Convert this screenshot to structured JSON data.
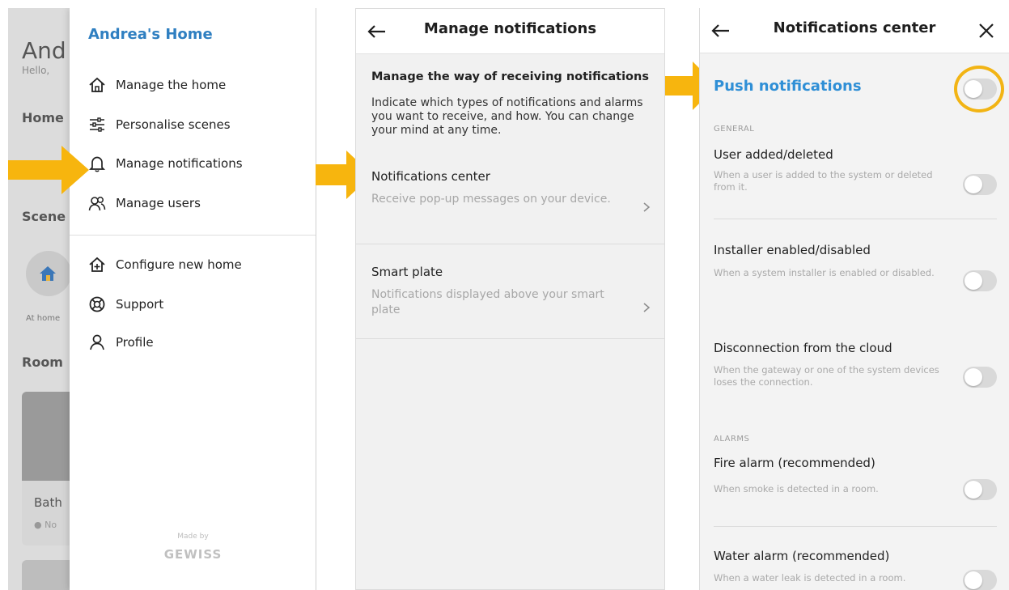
{
  "panel1": {
    "background": {
      "big_text": "And",
      "small_text": "Hello,",
      "section_home": "Home",
      "section_scenes": "Scene",
      "scene_label": "At home",
      "section_rooms": "Room",
      "room_card_title": "Bath",
      "room_card_status": "● No"
    },
    "drawer": {
      "title": "Andrea's Home",
      "items": [
        {
          "label": "Manage the home",
          "icon": "home-icon"
        },
        {
          "label": "Personalise scenes",
          "icon": "sliders-icon"
        },
        {
          "label": "Manage notifications",
          "icon": "bell-icon"
        },
        {
          "label": "Manage users",
          "icon": "users-icon"
        },
        {
          "label": "Configure new home",
          "icon": "home-plus-icon"
        },
        {
          "label": "Support",
          "icon": "lifebuoy-icon"
        },
        {
          "label": "Profile",
          "icon": "person-icon"
        }
      ],
      "made_by": "Made by",
      "brand": "GEWISS"
    }
  },
  "panel2": {
    "title": "Manage notifications",
    "intro_heading": "Manage the way of receiving notifications",
    "intro_text": "Indicate which types of notifications and alarms you want to receive, and how. You can change your mind at any time.",
    "rows": [
      {
        "title": "Notifications center",
        "subtitle": "Receive pop-up messages on your device."
      },
      {
        "title": "Smart plate",
        "subtitle": "Notifications displayed above your smart plate"
      }
    ]
  },
  "panel3": {
    "title": "Notifications center",
    "push_title": "Push notifications",
    "general_label": "GENERAL",
    "alarms_label": "ALARMS",
    "general_items": [
      {
        "title": "User added/deleted",
        "desc": "When a user is added to the system or deleted from it."
      },
      {
        "title": "Installer enabled/disabled",
        "desc": "When a system installer is enabled or disabled."
      },
      {
        "title": "Disconnection from the cloud",
        "desc": "When the gateway or one of the system devices loses the connection."
      }
    ],
    "alarm_items": [
      {
        "title": "Fire alarm (recommended)",
        "desc": "When smoke is detected in a room."
      },
      {
        "title": "Water alarm (recommended)",
        "desc": "When a water leak is detected in a room."
      }
    ]
  },
  "colors": {
    "accent_blue": "#2f8fd6",
    "highlight_yellow": "#f2b414",
    "toggle_off": "#d9d9d9"
  }
}
